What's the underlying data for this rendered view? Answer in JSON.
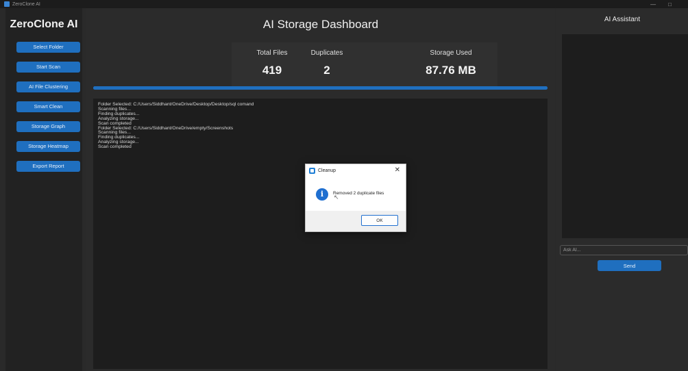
{
  "window": {
    "title": "ZeroClone AI",
    "controls": [
      "—",
      "□"
    ]
  },
  "sidebar": {
    "brand": "ZeroClone AI",
    "buttons": [
      {
        "label": "Select Folder"
      },
      {
        "label": "Start Scan"
      },
      {
        "label": "AI File Clustering"
      },
      {
        "label": "Smart Clean"
      },
      {
        "label": "Storage Graph"
      },
      {
        "label": "Storage Heatmap"
      },
      {
        "label": "Export Report"
      }
    ]
  },
  "main": {
    "title": "AI Storage Dashboard",
    "stats": {
      "total_files": {
        "label": "Total Files",
        "value": "419"
      },
      "duplicates": {
        "label": "Duplicates",
        "value": "2"
      },
      "storage_used": {
        "label": "Storage Used",
        "value": "87.76 MB"
      }
    },
    "progress": 1.0,
    "log": [
      "Folder Selected: C:/Users/Siddhant/OneDrive/Desktop/Desktop/sql comand",
      "Scanning files...",
      "Finding duplicates...",
      "Analyzing storage...",
      "Scan completed",
      "Folder Selected: C:/Users/Siddhant/OneDrive/empty/Screenshots",
      "Scanning files...",
      "Finding duplicates...",
      "Analyzing storage...",
      "Scan completed"
    ]
  },
  "assistant": {
    "title": "AI Assistant",
    "input_placeholder": "Ask AI...",
    "send_label": "Send"
  },
  "dialog": {
    "title": "Cleanup",
    "close": "✕",
    "message": "Removed 2 duplicate files",
    "ok_label": "OK"
  },
  "colors": {
    "accent": "#1f6fbf",
    "background": "#2a2a2a",
    "panel": "#1d1d1d"
  }
}
